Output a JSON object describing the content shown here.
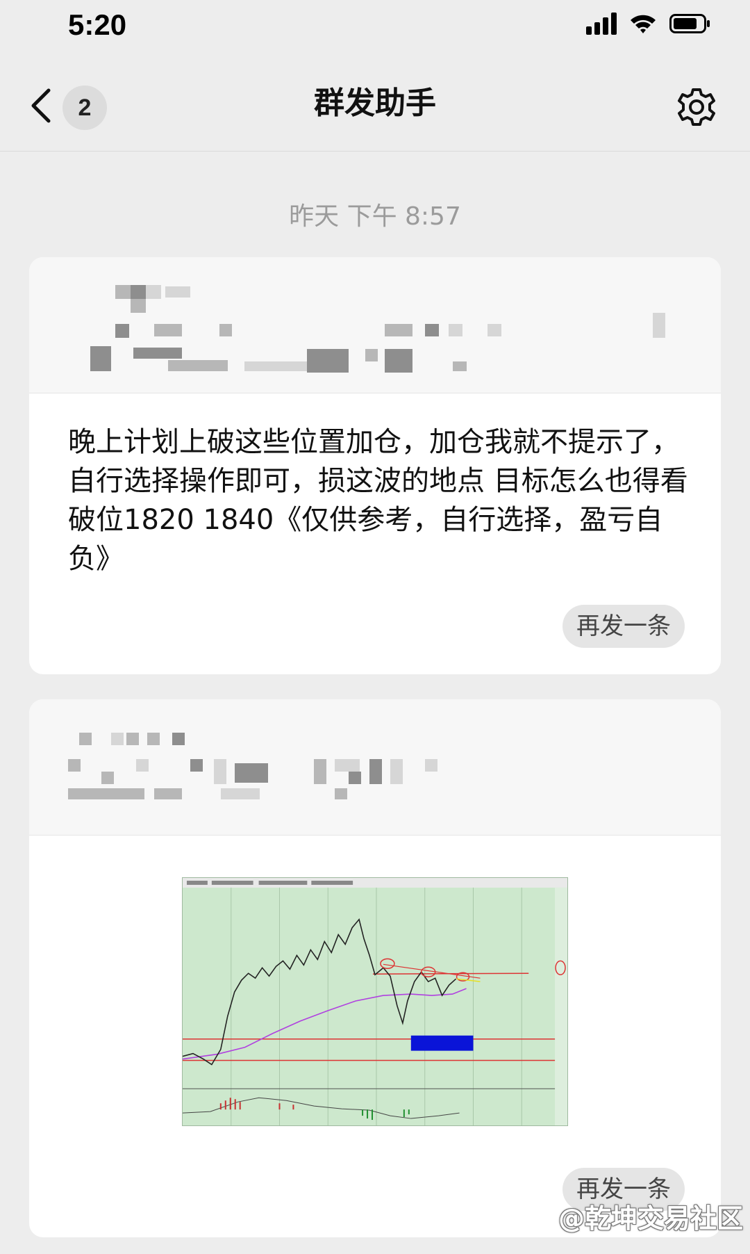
{
  "status_bar": {
    "time": "5:20",
    "icons": [
      "cellular-signal-icon",
      "wifi-icon",
      "battery-icon"
    ]
  },
  "nav": {
    "back_icon": "chevron-left-icon",
    "unread_count": "2",
    "title": "群发助手",
    "settings_icon": "gear-icon"
  },
  "timestamp": "昨天 下午 8:57",
  "messages": [
    {
      "recipients_pixelated": true,
      "text": "晚上计划上破这些位置加仓，加仓我就不提示了，自行选择操作即可，损这波的地点 目标怎么也得看破位1820  1840《仅供参考，自行选择，盈亏自负》",
      "resend_label": "再发一条"
    },
    {
      "recipients_pixelated": true,
      "image": "candlestick-chart-screenshot",
      "resend_label": "再发一条"
    }
  ],
  "colors": {
    "background": "#ededed",
    "card": "#ffffff",
    "chart_background": "#cde8cd",
    "highlight_box": "#0a14d8"
  },
  "watermark": "@乾坤交易社区"
}
